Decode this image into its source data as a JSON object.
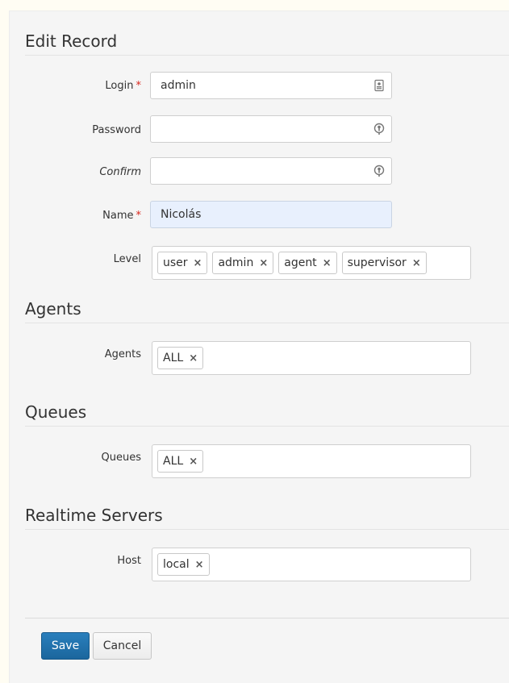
{
  "sections": {
    "edit_record": "Edit Record",
    "agents": "Agents",
    "queues": "Queues",
    "realtime_servers": "Realtime Servers"
  },
  "fields": {
    "login": {
      "label": "Login",
      "required_mark": "*",
      "value": "admin",
      "icon": "contact-card-icon"
    },
    "password": {
      "label": "Password",
      "value": "",
      "icon": "key-icon"
    },
    "confirm": {
      "label": "Confirm",
      "value": "",
      "icon": "key-icon"
    },
    "name": {
      "label": "Name",
      "required_mark": "*",
      "value": "Nicolás"
    },
    "level": {
      "label": "Level",
      "tags": [
        "user",
        "admin",
        "agent",
        "supervisor"
      ]
    },
    "agents": {
      "label": "Agents",
      "tags": [
        "ALL"
      ]
    },
    "queues": {
      "label": "Queues",
      "tags": [
        "ALL"
      ]
    },
    "host": {
      "label": "Host",
      "tags": [
        "local"
      ]
    }
  },
  "tag_remove_symbol": "×",
  "buttons": {
    "save": "Save",
    "cancel": "Cancel"
  },
  "colors": {
    "primary_button": "#1f6fa8",
    "required": "#d9271d",
    "autofill_bg": "#e8f0fd"
  }
}
